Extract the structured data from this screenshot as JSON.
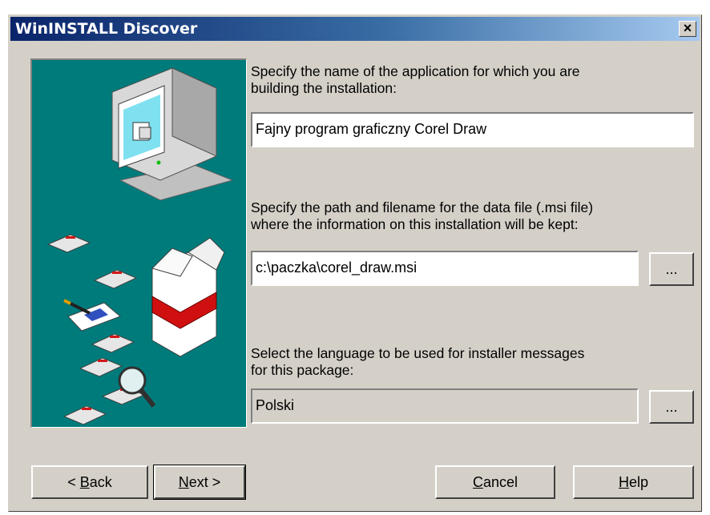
{
  "window": {
    "title": "WinINSTALL Discover",
    "close_glyph": "×"
  },
  "fields": {
    "app_name": {
      "label": "Specify the name of the application for which you are\nbuilding the installation:",
      "value": "Fajny program graficzny Corel Draw"
    },
    "msi_path": {
      "label": "Specify the path and filename for the data file (.msi file)\nwhere the information on this installation will be kept:",
      "value": "c:\\paczka\\corel_draw.msi",
      "browse_label": "..."
    },
    "language": {
      "label": "Select the language to be used for installer messages\nfor this package:",
      "value": "Polski",
      "browse_label": "..."
    }
  },
  "buttons": {
    "back": {
      "pre": "< ",
      "accel": "B",
      "rest": "ack"
    },
    "next": {
      "accel": "N",
      "rest": "ext >"
    },
    "cancel": {
      "accel": "C",
      "rest": "ancel"
    },
    "help": {
      "accel": "H",
      "rest": "elp"
    }
  },
  "colors": {
    "titlebar_start": "#0a246a",
    "titlebar_end": "#a6caf0",
    "dialog_bg": "#d4d0c8",
    "art_bg": "#007b7b"
  }
}
